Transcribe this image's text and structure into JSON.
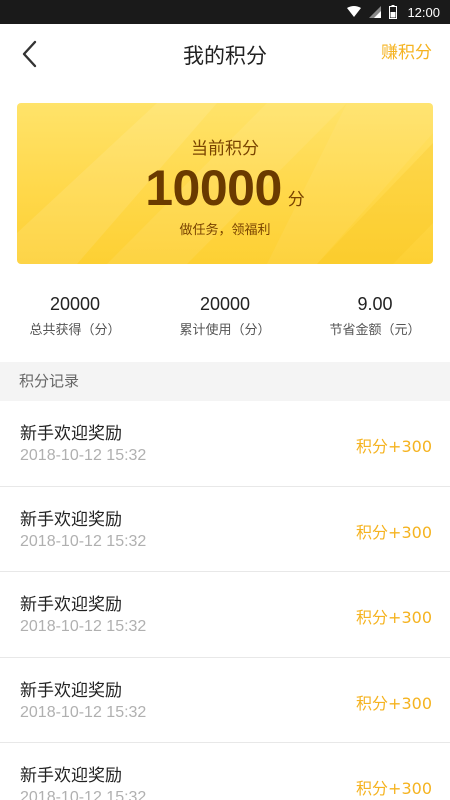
{
  "status_bar": {
    "time": "12:00",
    "icons": [
      "wifi-icon",
      "signal-icon",
      "battery-icon"
    ]
  },
  "header": {
    "title": "我的积分",
    "action_label": "赚积分",
    "back_icon": "chevron-left-icon"
  },
  "card": {
    "label": "当前积分",
    "value": "10000",
    "unit": "分",
    "subtitle": "做任务，领福利"
  },
  "stats": [
    {
      "value": "20000",
      "label": "总共获得（分）"
    },
    {
      "value": "20000",
      "label": "累计使用（分）"
    },
    {
      "value": "9.00",
      "label": "节省金额（元）"
    }
  ],
  "section_title": "积分记录",
  "records": [
    {
      "title": "新手欢迎奖励",
      "time": "2018-10-12 15:32",
      "points": "积分+300"
    },
    {
      "title": "新手欢迎奖励",
      "time": "2018-10-12 15:32",
      "points": "积分+300"
    },
    {
      "title": "新手欢迎奖励",
      "time": "2018-10-12 15:32",
      "points": "积分+300"
    },
    {
      "title": "新手欢迎奖励",
      "time": "2018-10-12 15:32",
      "points": "积分+300"
    },
    {
      "title": "新手欢迎奖励",
      "time": "2018-10-12 15:32",
      "points": "积分+300"
    }
  ],
  "colors": {
    "accent": "#f5b320",
    "card_yellow": "#ffd84a",
    "card_text": "#6a3a00"
  }
}
